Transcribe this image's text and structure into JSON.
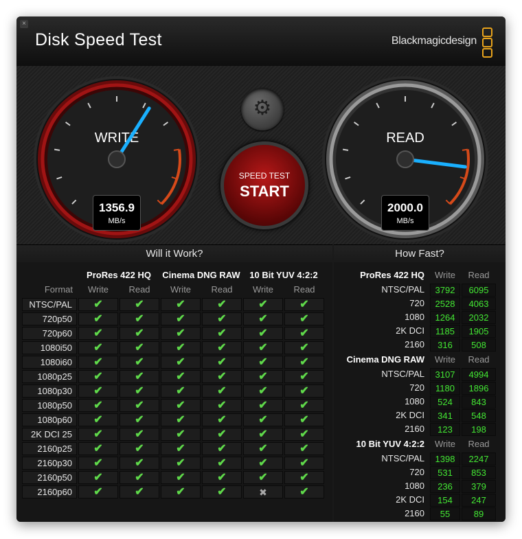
{
  "window": {
    "title": "Disk Speed Test",
    "brand": "Blackmagicdesign",
    "close_label": "×"
  },
  "gauges": {
    "write": {
      "label": "WRITE",
      "value": "1356.9",
      "unit": "MB/s",
      "needle_fraction": 0.62
    },
    "read": {
      "label": "READ",
      "value": "2000.0",
      "unit": "MB/s",
      "needle_fraction": 0.86
    }
  },
  "controls": {
    "settings_icon": "gear-icon",
    "start_sub": "SPEED TEST",
    "start_main": "START"
  },
  "will_it_work": {
    "title": "Will it Work?",
    "format_label": "Format",
    "codecs": [
      "ProRes 422 HQ",
      "Cinema DNG RAW",
      "10 Bit YUV 4:2:2"
    ],
    "write_label": "Write",
    "read_label": "Read",
    "rows": [
      {
        "format": "NTSC/PAL",
        "ok": [
          true,
          true,
          true,
          true,
          true,
          true
        ]
      },
      {
        "format": "720p50",
        "ok": [
          true,
          true,
          true,
          true,
          true,
          true
        ]
      },
      {
        "format": "720p60",
        "ok": [
          true,
          true,
          true,
          true,
          true,
          true
        ]
      },
      {
        "format": "1080i50",
        "ok": [
          true,
          true,
          true,
          true,
          true,
          true
        ]
      },
      {
        "format": "1080i60",
        "ok": [
          true,
          true,
          true,
          true,
          true,
          true
        ]
      },
      {
        "format": "1080p25",
        "ok": [
          true,
          true,
          true,
          true,
          true,
          true
        ]
      },
      {
        "format": "1080p30",
        "ok": [
          true,
          true,
          true,
          true,
          true,
          true
        ]
      },
      {
        "format": "1080p50",
        "ok": [
          true,
          true,
          true,
          true,
          true,
          true
        ]
      },
      {
        "format": "1080p60",
        "ok": [
          true,
          true,
          true,
          true,
          true,
          true
        ]
      },
      {
        "format": "2K DCI 25",
        "ok": [
          true,
          true,
          true,
          true,
          true,
          true
        ]
      },
      {
        "format": "2160p25",
        "ok": [
          true,
          true,
          true,
          true,
          true,
          true
        ]
      },
      {
        "format": "2160p30",
        "ok": [
          true,
          true,
          true,
          true,
          true,
          true
        ]
      },
      {
        "format": "2160p50",
        "ok": [
          true,
          true,
          true,
          true,
          true,
          true
        ]
      },
      {
        "format": "2160p60",
        "ok": [
          true,
          true,
          true,
          true,
          false,
          true
        ]
      }
    ],
    "check_glyph": "✔",
    "cross_glyph": "✖"
  },
  "how_fast": {
    "title": "How Fast?",
    "write_label": "Write",
    "read_label": "Read",
    "groups": [
      {
        "codec": "ProRes 422 HQ",
        "rows": [
          {
            "res": "NTSC/PAL",
            "write": "3792",
            "read": "6095"
          },
          {
            "res": "720",
            "write": "2528",
            "read": "4063"
          },
          {
            "res": "1080",
            "write": "1264",
            "read": "2032"
          },
          {
            "res": "2K DCI",
            "write": "1185",
            "read": "1905"
          },
          {
            "res": "2160",
            "write": "316",
            "read": "508"
          }
        ]
      },
      {
        "codec": "Cinema DNG RAW",
        "rows": [
          {
            "res": "NTSC/PAL",
            "write": "3107",
            "read": "4994"
          },
          {
            "res": "720",
            "write": "1180",
            "read": "1896"
          },
          {
            "res": "1080",
            "write": "524",
            "read": "843"
          },
          {
            "res": "2K DCI",
            "write": "341",
            "read": "548"
          },
          {
            "res": "2160",
            "write": "123",
            "read": "198"
          }
        ]
      },
      {
        "codec": "10 Bit YUV 4:2:2",
        "rows": [
          {
            "res": "NTSC/PAL",
            "write": "1398",
            "read": "2247"
          },
          {
            "res": "720",
            "write": "531",
            "read": "853"
          },
          {
            "res": "1080",
            "write": "236",
            "read": "379"
          },
          {
            "res": "2K DCI",
            "write": "154",
            "read": "247"
          },
          {
            "res": "2160",
            "write": "55",
            "read": "89"
          }
        ]
      }
    ]
  },
  "colors": {
    "accent_red": "#c21414",
    "needle_blue": "#1ab0ff",
    "value_green": "#43e833",
    "brand_orange": "#e8a31c"
  }
}
